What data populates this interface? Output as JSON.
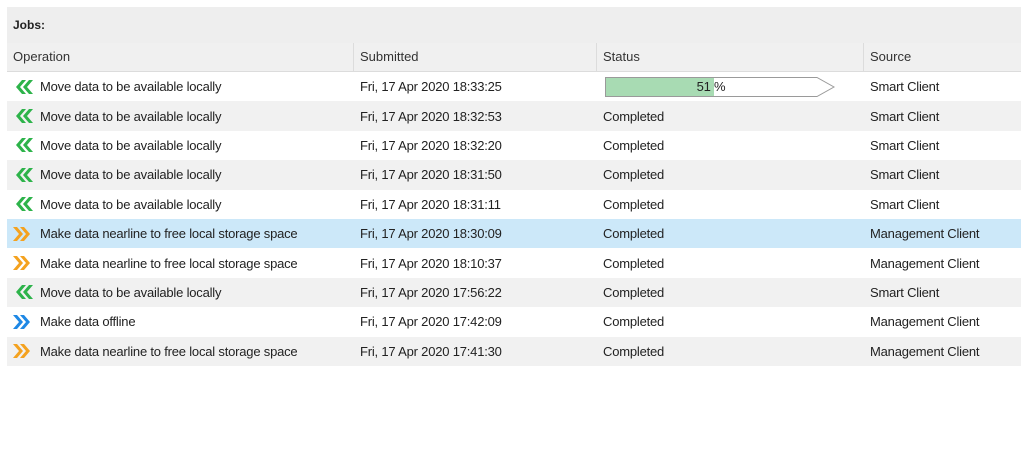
{
  "panel": {
    "title": "Jobs:"
  },
  "columns": [
    "Operation",
    "Submitted",
    "Status",
    "Source"
  ],
  "colors": {
    "move_local": "#2db34a",
    "nearline": "#f4a21f",
    "offline": "#1e88e5",
    "progress_fill": "#a8dbb3",
    "selected": "#cce8f9"
  },
  "jobs": [
    {
      "type": "move-local",
      "icon": "chevrons-left-icon",
      "operation": "Move data to be available locally",
      "submitted": "Fri, 17 Apr 2020 18:33:25",
      "status": "51 %",
      "progress": 0.51,
      "source": "Smart Client"
    },
    {
      "type": "move-local",
      "icon": "chevrons-left-icon",
      "operation": "Move data to be available locally",
      "submitted": "Fri, 17 Apr 2020 18:32:53",
      "status": "Completed",
      "source": "Smart Client"
    },
    {
      "type": "move-local",
      "icon": "chevrons-left-icon",
      "operation": "Move data to be available locally",
      "submitted": "Fri, 17 Apr 2020 18:32:20",
      "status": "Completed",
      "source": "Smart Client"
    },
    {
      "type": "move-local",
      "icon": "chevrons-left-icon",
      "operation": "Move data to be available locally",
      "submitted": "Fri, 17 Apr 2020 18:31:50",
      "status": "Completed",
      "source": "Smart Client"
    },
    {
      "type": "move-local",
      "icon": "chevrons-left-icon",
      "operation": "Move data to be available locally",
      "submitted": "Fri, 17 Apr 2020 18:31:11",
      "status": "Completed",
      "source": "Smart Client"
    },
    {
      "type": "nearline",
      "icon": "chevrons-right-icon",
      "operation": "Make data nearline to free local storage space",
      "submitted": "Fri, 17 Apr 2020 18:30:09",
      "status": "Completed",
      "source": "Management Client",
      "selected": true
    },
    {
      "type": "nearline",
      "icon": "chevrons-right-icon",
      "operation": "Make data nearline to free local storage space",
      "submitted": "Fri, 17 Apr 2020 18:10:37",
      "status": "Completed",
      "source": "Management Client"
    },
    {
      "type": "move-local",
      "icon": "chevrons-left-icon",
      "operation": "Move data to be available locally",
      "submitted": "Fri, 17 Apr 2020 17:56:22",
      "status": "Completed",
      "source": "Smart Client"
    },
    {
      "type": "offline",
      "icon": "chevrons-right-icon",
      "operation": "Make data offline",
      "submitted": "Fri, 17 Apr 2020 17:42:09",
      "status": "Completed",
      "source": "Management Client"
    },
    {
      "type": "nearline",
      "icon": "chevrons-right-icon",
      "operation": "Make data nearline to free local storage space",
      "submitted": "Fri, 17 Apr 2020 17:41:30",
      "status": "Completed",
      "source": "Management Client"
    }
  ]
}
